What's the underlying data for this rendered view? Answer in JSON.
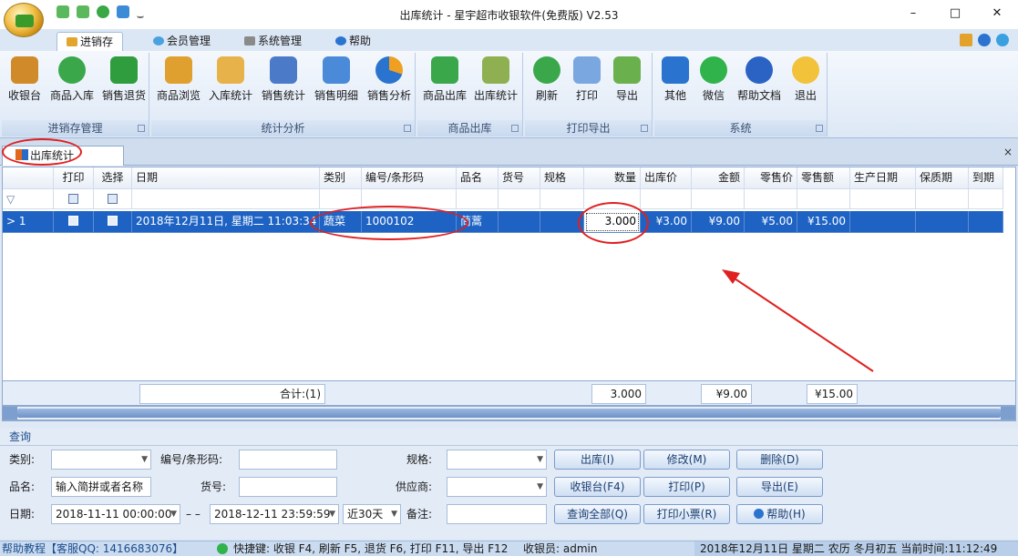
{
  "window": {
    "title": "出库统计 - 星宇超市收银软件(免费版) V2.53",
    "controls": [
      "–",
      "□",
      "✕"
    ]
  },
  "ribbon_tabs": [
    {
      "label": "进销存",
      "active": true,
      "icon": "box-icon"
    },
    {
      "label": "会员管理",
      "active": false,
      "icon": "members-icon"
    },
    {
      "label": "系统管理",
      "active": false,
      "icon": "wrench-icon"
    },
    {
      "label": "帮助",
      "active": false,
      "icon": "help-icon"
    }
  ],
  "ribbon_groups": [
    {
      "label": "进销存管理",
      "buttons": [
        "收银台",
        "商品入库",
        "销售退货"
      ]
    },
    {
      "label": "统计分析",
      "buttons": [
        "商品浏览",
        "入库统计",
        "销售统计",
        "销售明细",
        "销售分析"
      ]
    },
    {
      "label": "商品出库",
      "buttons": [
        "商品出库",
        "出库统计"
      ]
    },
    {
      "label": "打印导出",
      "buttons": [
        "刷新",
        "打印",
        "导出"
      ]
    },
    {
      "label": "系统",
      "buttons": [
        "其他",
        "微信",
        "帮助文档",
        "退出"
      ]
    }
  ],
  "doc_tab": {
    "label": "出库统计",
    "close": "×"
  },
  "grid": {
    "columns": [
      "打印",
      "选择",
      "日期",
      "类别",
      "编号/条形码",
      "品名",
      "货号",
      "规格",
      "数量",
      "出库价",
      "金额",
      "零售价",
      "零售额",
      "生产日期",
      "保质期",
      "到期"
    ],
    "filter_icon": "▽",
    "rows": [
      {
        "row_num": "1",
        "indicator": ">",
        "date": "2018年12月11日, 星期二 11:03:34",
        "category": "蔬菜",
        "code": "1000102",
        "name": "茼蒿",
        "item_no": "",
        "spec": "",
        "qty": "3.000",
        "out_price": "¥3.00",
        "amount": "¥9.00",
        "retail_price": "¥5.00",
        "retail_amount": "¥15.00"
      }
    ],
    "summary": {
      "count": "合计:(1)",
      "qty": "3.000",
      "amount": "¥9.00",
      "retail_amount": "¥15.00"
    }
  },
  "query": {
    "title": "查询",
    "category_label": "类别:",
    "code_label": "编号/条形码:",
    "spec_label": "规格:",
    "name_label": "品名:",
    "name_placeholder": "输入简拼或者名称",
    "item_no_label": "货号:",
    "supplier_label": "供应商:",
    "date_label": "日期:",
    "date_from": "2018-11-11 00:00:00",
    "date_sep": "– –",
    "date_to": "2018-12-11 23:59:59",
    "range": "近30天",
    "note_label": "备注:",
    "buttons": [
      "出库(I)",
      "修改(M)",
      "删除(D)",
      "收银台(F4)",
      "打印(P)",
      "导出(E)",
      "查询全部(Q)",
      "打印小票(R)",
      "帮助(H)"
    ]
  },
  "status": {
    "left": "帮助教程【客服QQ: 1416683076】",
    "shortcuts": "快捷键: 收银 F4, 刷新 F5, 退货 F6, 打印 F11, 导出 F12",
    "user": "收银员: admin",
    "right": "2018年12月11日 星期二 农历 冬月初五 当前时间:11:12:49"
  },
  "colors": {
    "selection": "#1e63c4",
    "annotation": "#e02020"
  }
}
